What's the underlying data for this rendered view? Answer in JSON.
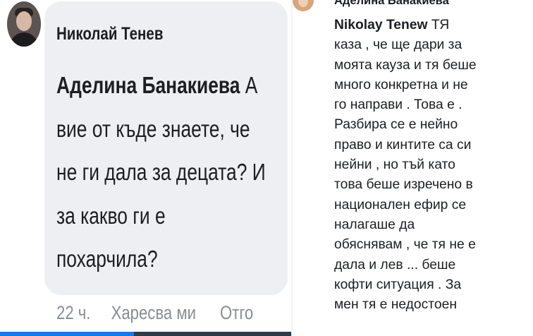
{
  "left": {
    "author": "Николай Тенев",
    "mention": "Аделина Банакиева",
    "lines": [
      "А",
      "вие от къде знаете, че",
      "не ги дала за децата? И",
      "за какво ги е",
      "похарчила?"
    ],
    "time": "22 ч.",
    "like": "Харесва ми",
    "reply": "Отго"
  },
  "right": {
    "author": "Аделина Банакиева",
    "mention": "Nikolay Tenew",
    "first_line_rest": "ТЯ",
    "lines": [
      "каза , че ще дари за",
      "моята кауза и тя беше",
      "много конкретна и не",
      "го направи . Това е .",
      "Разбира се е нейно",
      "право и кинтите са си",
      "нейни , но тъй като",
      "това беше изречено в",
      "национален ефир се",
      "налагаше да",
      "обяснявам , че тя не е",
      "дала и лев ... беше",
      "кофти ситуация . За",
      "мен тя е недостоен"
    ]
  },
  "colors": {
    "bubble": "#eeeff2",
    "text": "#1c1e21",
    "meta": "#8a8d91"
  }
}
